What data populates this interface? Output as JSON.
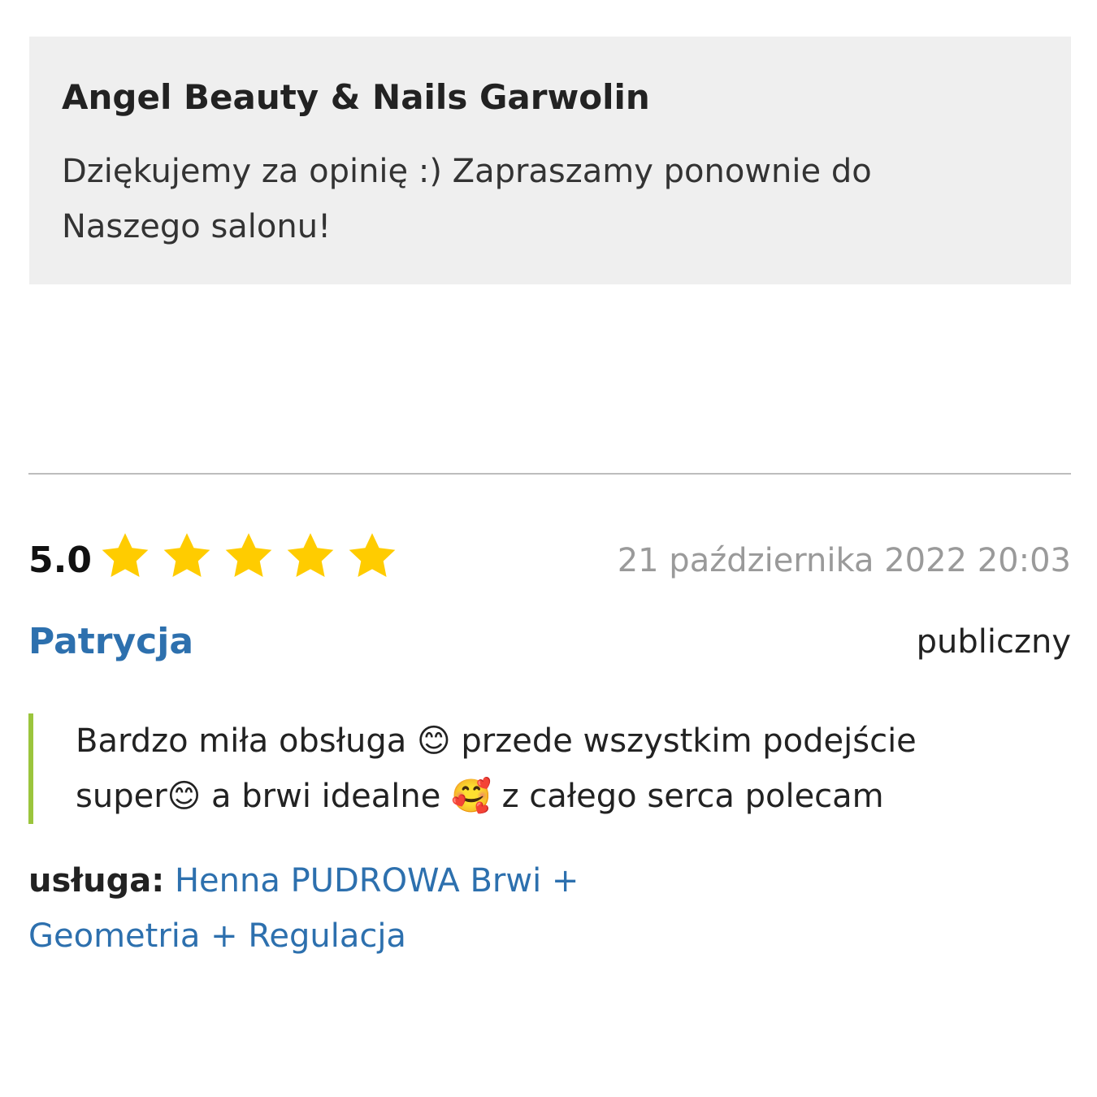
{
  "reply": {
    "author": "Angel Beauty & Nails Garwolin",
    "text": "Dziękujemy za opinię :) Zapraszamy ponownie do Naszego salonu!"
  },
  "review": {
    "rating": "5.0",
    "rating_value": 5,
    "rating_max": 5,
    "star_color": "#ffcc00",
    "date": "21 października 2022 20:03",
    "author": "Patrycja",
    "visibility": "publiczny",
    "body": "Bardzo miła obsługa 😊 przede wszystkim podejście super😊 a brwi idealne 🥰 z całego serca polecam",
    "service_label": "usługa:",
    "service_name": "Henna PUDROWA Brwi + Geometria + Regulacja"
  },
  "colors": {
    "link": "#2d70ae",
    "quote_border": "#9bc53d",
    "reply_background": "#efefef",
    "date_text": "#9a9a9a"
  }
}
